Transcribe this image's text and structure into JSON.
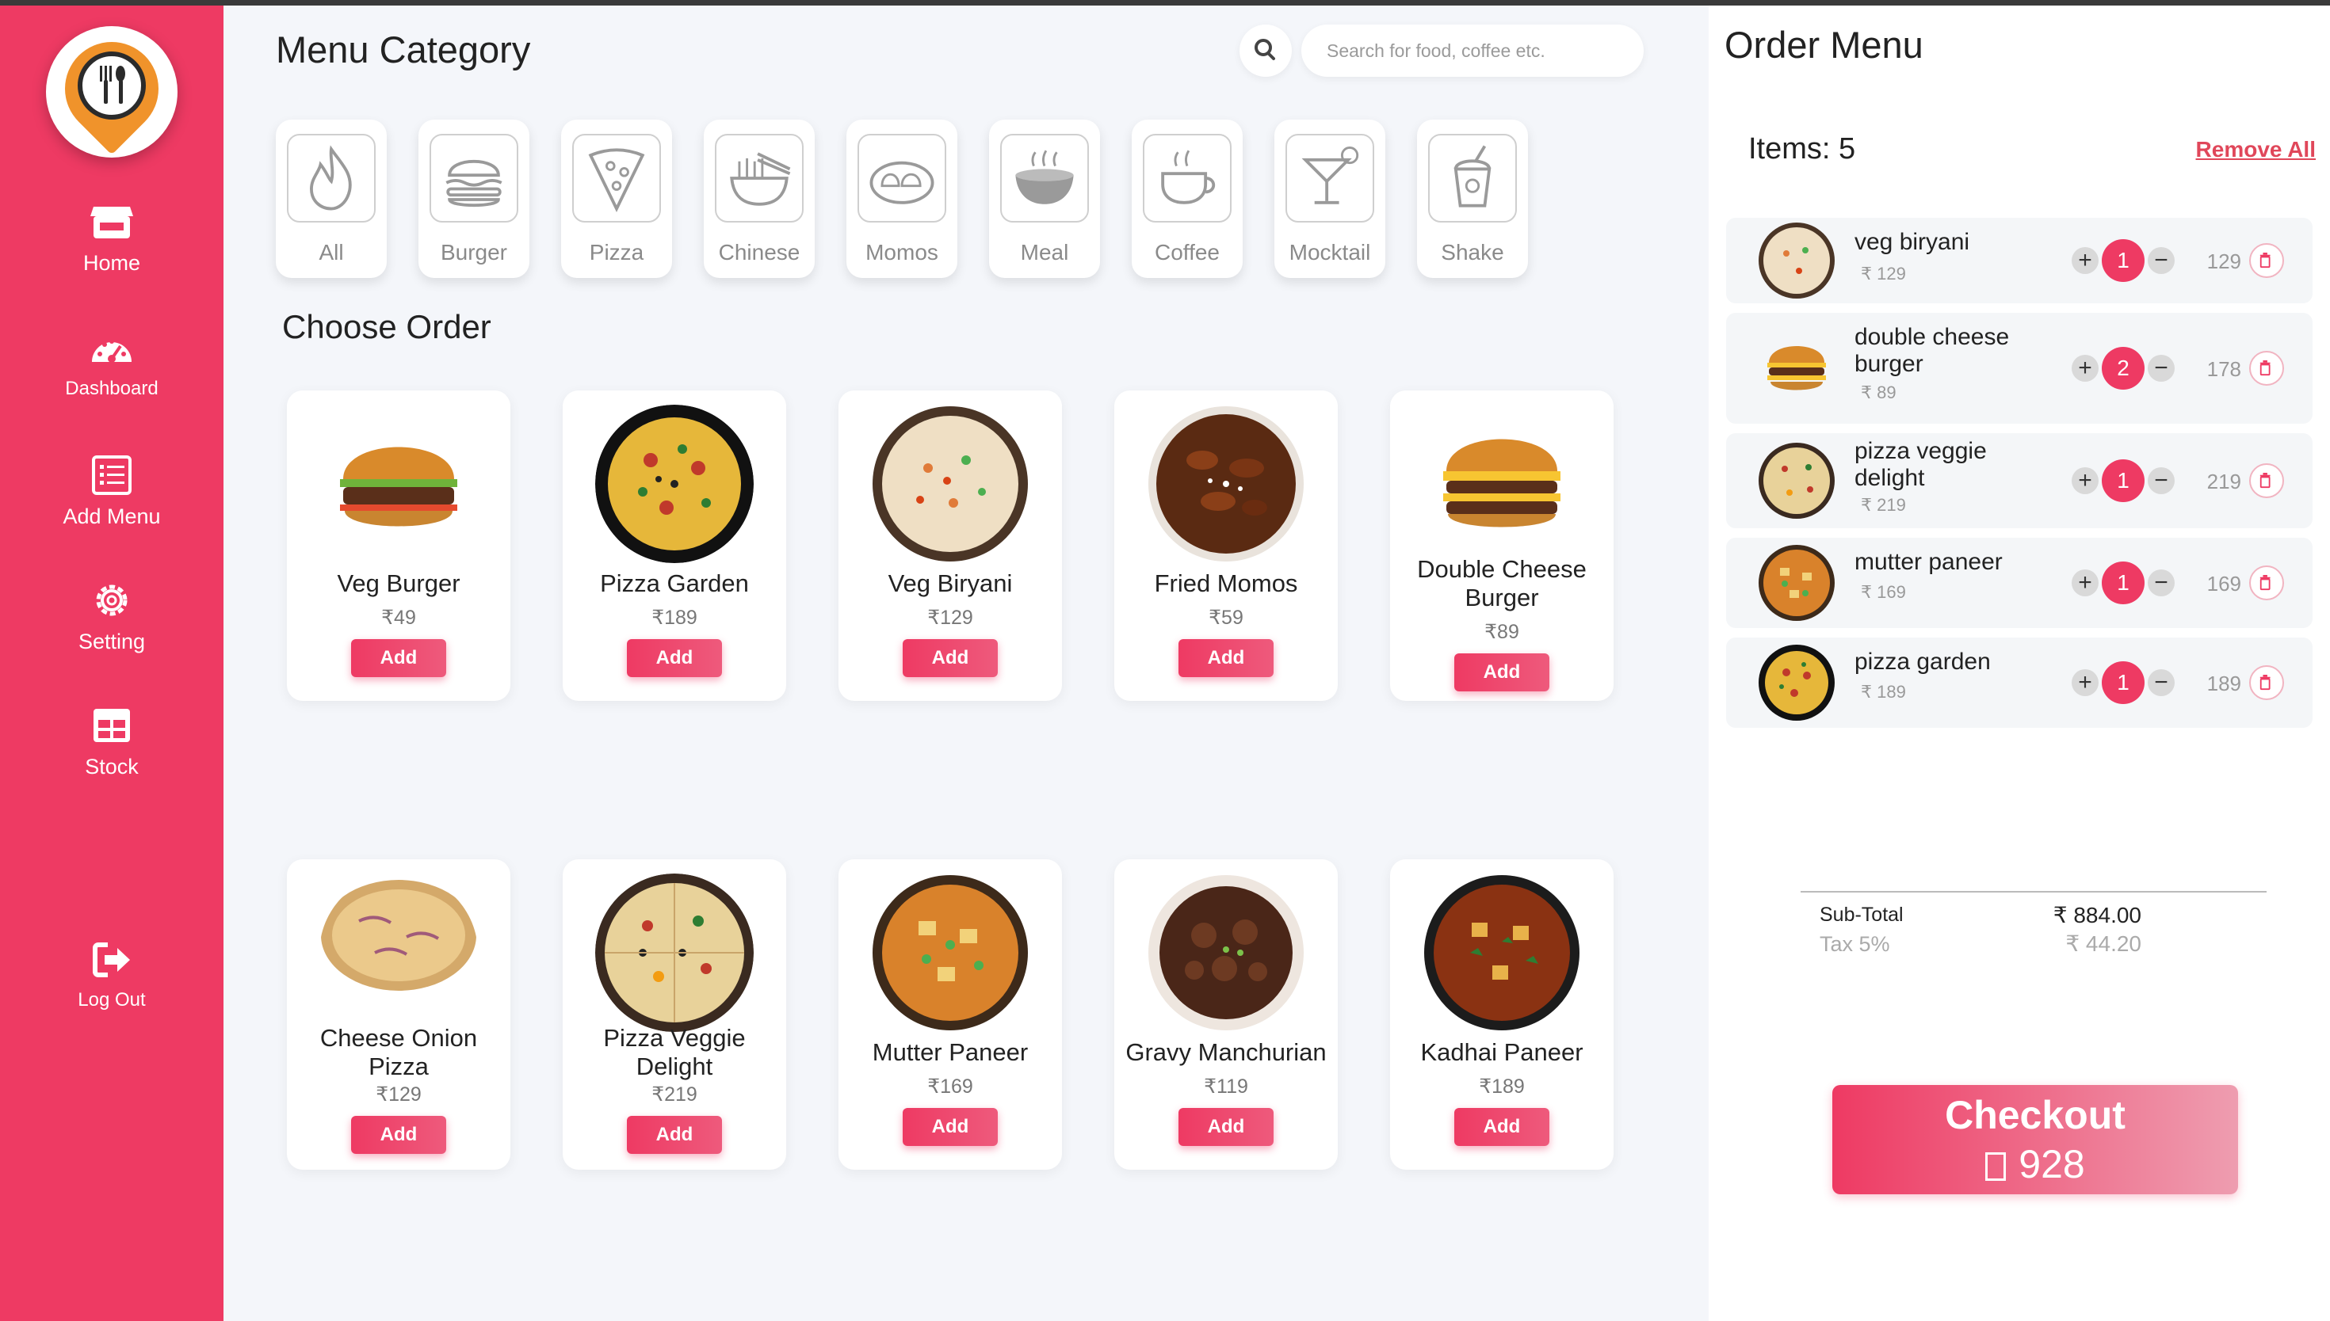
{
  "sidebar": {
    "items": [
      {
        "label": "Home",
        "icon": "store-icon"
      },
      {
        "label": "Dashboard",
        "icon": "gauge-icon"
      },
      {
        "label": "Add Menu",
        "icon": "list-icon"
      },
      {
        "label": "Setting",
        "icon": "gear-icon"
      },
      {
        "label": "Stock",
        "icon": "grid-icon"
      },
      {
        "label": "Log Out",
        "icon": "logout-icon"
      }
    ]
  },
  "main": {
    "menu_title": "Menu Category",
    "search_placeholder": "Search for food, coffee etc.",
    "categories": [
      {
        "label": "All",
        "icon": "flame-icon"
      },
      {
        "label": "Burger",
        "icon": "burger-icon"
      },
      {
        "label": "Pizza",
        "icon": "pizza-icon"
      },
      {
        "label": "Chinese",
        "icon": "noodles-icon"
      },
      {
        "label": "Momos",
        "icon": "momos-icon"
      },
      {
        "label": "Meal",
        "icon": "meal-icon"
      },
      {
        "label": "Coffee",
        "icon": "coffee-icon"
      },
      {
        "label": "Mocktail",
        "icon": "mocktail-icon"
      },
      {
        "label": "Shake",
        "icon": "shake-icon"
      }
    ],
    "order_title": "Choose Order",
    "add_label": "Add",
    "foods": [
      {
        "name": "Veg Burger",
        "price": "₹49"
      },
      {
        "name": "Pizza Garden",
        "price": "₹189"
      },
      {
        "name": "Veg Biryani",
        "price": "₹129"
      },
      {
        "name": "Fried Momos",
        "price": "₹59"
      },
      {
        "name": "Double Cheese Burger",
        "price": "₹89"
      },
      {
        "name": "Cheese Onion Pizza",
        "price": "₹129"
      },
      {
        "name": "Pizza Veggie Delight",
        "price": "₹219"
      },
      {
        "name": "Mutter Paneer",
        "price": "₹169"
      },
      {
        "name": "Gravy Manchurian",
        "price": "₹119"
      },
      {
        "name": "Kadhai Paneer",
        "price": "₹189"
      }
    ]
  },
  "order": {
    "title": "Order Menu",
    "items_label": "Items: 5",
    "remove_all": "Remove All",
    "rows": [
      {
        "name": "veg biryani",
        "unit": "₹ 129",
        "qty": "1",
        "total": "129",
        "plus": "+",
        "minus": "−"
      },
      {
        "name": "double cheese burger",
        "unit": "₹ 89",
        "qty": "2",
        "total": "178",
        "plus": "+",
        "minus": "−"
      },
      {
        "name": "pizza veggie delight",
        "unit": "₹ 219",
        "qty": "1",
        "total": "219",
        "plus": "+",
        "minus": "−"
      },
      {
        "name": "mutter paneer",
        "unit": "₹ 169",
        "qty": "1",
        "total": "169",
        "plus": "+",
        "minus": "−"
      },
      {
        "name": "pizza garden",
        "unit": "₹ 189",
        "qty": "1",
        "total": "189",
        "plus": "+",
        "minus": "−"
      }
    ],
    "subtotal_label": "Sub-Total",
    "subtotal_value": "₹ 884.00",
    "tax_label": "Tax 5%",
    "tax_value": "₹ 44.20",
    "checkout_label": "Checkout",
    "checkout_amount": "928"
  },
  "colors": {
    "accent": "#ee3a63",
    "panel_bg": "#f4f6fa"
  }
}
